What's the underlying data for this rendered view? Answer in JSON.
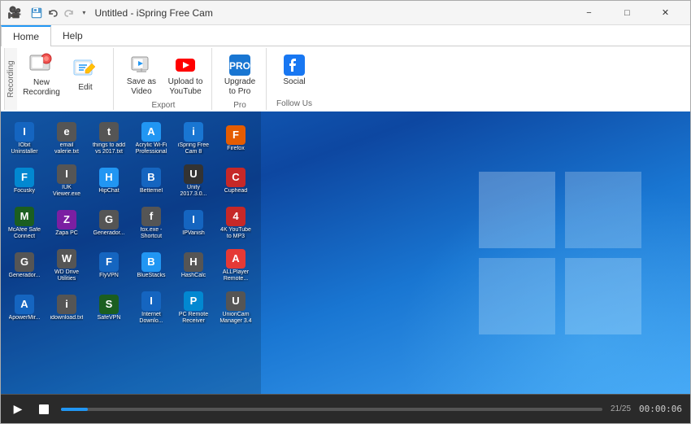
{
  "window": {
    "title": "Untitled - iSpring Free Cam",
    "controls": {
      "minimize": "−",
      "maximize": "□",
      "close": "✕"
    }
  },
  "quickaccess": {
    "save_icon": "💾",
    "undo_icon": "↩",
    "dropdown": "▾"
  },
  "tabs": {
    "home": "Home",
    "help": "Help"
  },
  "ribbon": {
    "groups": [
      {
        "label": "Recording",
        "items": [
          {
            "id": "new-recording",
            "label": "New\nRecording",
            "type": "large"
          },
          {
            "id": "edit",
            "label": "Edit",
            "type": "large"
          }
        ]
      },
      {
        "label": "Export",
        "items": [
          {
            "id": "save-as-video",
            "label": "Save as\nVideo",
            "type": "small"
          },
          {
            "id": "upload-youtube",
            "label": "Upload to\nYouTube",
            "type": "small"
          }
        ]
      },
      {
        "label": "Pro",
        "items": [
          {
            "id": "upgrade-pro",
            "label": "Upgrade\nto Pro",
            "type": "small"
          }
        ]
      },
      {
        "label": "Follow Us",
        "items": [
          {
            "id": "social",
            "label": "Social",
            "type": "small"
          }
        ]
      }
    ],
    "recording_label": "Recording"
  },
  "desktop": {
    "icons": [
      {
        "label": "IObit\nUninstaller",
        "color": "#1565c0"
      },
      {
        "label": "email\nvalerie.txt",
        "color": "#555"
      },
      {
        "label": "things to add\nvs 2017.txt",
        "color": "#555"
      },
      {
        "label": "Acrylic Wi-Fi\nProfessional",
        "color": "#2196F3"
      },
      {
        "label": "iSpring Free\nCam 8",
        "color": "#1976d2"
      },
      {
        "label": "",
        "color": "transparent"
      },
      {
        "label": "Firefox",
        "color": "#e55c00"
      },
      {
        "label": "Focusky",
        "color": "#0288d1"
      },
      {
        "label": "IUK\nViewer.exe",
        "color": "#555"
      },
      {
        "label": "HipChat",
        "color": "#2196F3"
      },
      {
        "label": "",
        "color": "transparent"
      },
      {
        "label": "",
        "color": "transparent"
      },
      {
        "label": "Betternel",
        "color": "#1565c0"
      },
      {
        "label": "Unity\n2017.3.0...",
        "color": "#333"
      },
      {
        "label": "Cuphead",
        "color": "#c62828"
      },
      {
        "label": "McAfee Safe\nConnect",
        "color": "#1b5e20"
      },
      {
        "label": "",
        "color": "transparent"
      },
      {
        "label": "",
        "color": "transparent"
      },
      {
        "label": "Zapa PC",
        "color": "#7b1fa2"
      },
      {
        "label": "Generador...",
        "color": "#555"
      },
      {
        "label": "fox.exe -\nShortcut",
        "color": "#555"
      },
      {
        "label": "IPVanish",
        "color": "#1565c0"
      },
      {
        "label": "",
        "color": "transparent"
      },
      {
        "label": "",
        "color": "transparent"
      },
      {
        "label": "4K YouTube\nto MP3",
        "color": "#c62828"
      },
      {
        "label": "Generador...",
        "color": "#555"
      },
      {
        "label": "WD Drive\nUtilities",
        "color": "#555"
      },
      {
        "label": "FlyVPN",
        "color": "#1565c0"
      },
      {
        "label": "",
        "color": "transparent"
      },
      {
        "label": "",
        "color": "transparent"
      },
      {
        "label": "BlueStacks",
        "color": "#2196F3"
      },
      {
        "label": "HashCalc",
        "color": "#555"
      },
      {
        "label": "ALLPlayer\nRemote...",
        "color": "#e53935"
      },
      {
        "label": "ApowerMir...",
        "color": "#1565c0"
      },
      {
        "label": "",
        "color": "transparent"
      },
      {
        "label": "idownload.txt",
        "color": "#555"
      },
      {
        "label": "SafeVPN",
        "color": "#1b5e20"
      },
      {
        "label": "Internet\nDownlo...",
        "color": "#1565c0"
      },
      {
        "label": "PC Remote\nReceiver",
        "color": "#0288d1"
      },
      {
        "label": "UnionCam\nManager 3.4",
        "color": "#555"
      }
    ]
  },
  "bottom_bar": {
    "play_icon": "▶",
    "stop_icon": "■",
    "counter": "21/25",
    "time": "00:00:06",
    "progress_pct": 5
  }
}
